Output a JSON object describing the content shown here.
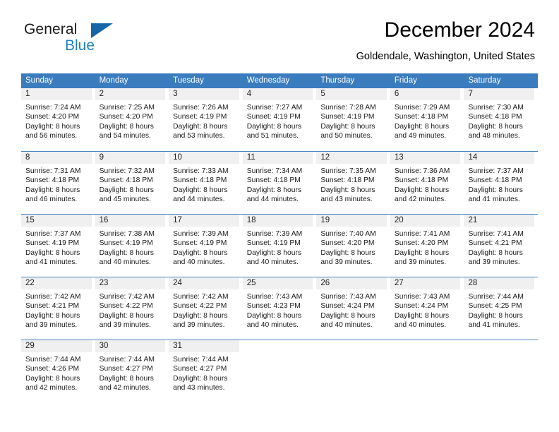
{
  "brand": {
    "name_top": "General",
    "name_bottom": "Blue",
    "triangle_color": "#1565a8",
    "blue_color": "#1e7fc4"
  },
  "header": {
    "title": "December 2024",
    "subtitle": "Goldendale, Washington, United States"
  },
  "theme": {
    "header_row_bg": "#3a7cbe",
    "header_row_text": "#ffffff",
    "day_number_bg": "#f0f0f0",
    "row_separator": "#4a84c0"
  },
  "calendar": {
    "weekday_headers": [
      "Sunday",
      "Monday",
      "Tuesday",
      "Wednesday",
      "Thursday",
      "Friday",
      "Saturday"
    ],
    "weeks": [
      [
        {
          "day": "1",
          "sunrise": "Sunrise: 7:24 AM",
          "sunset": "Sunset: 4:20 PM",
          "daylight_line1": "Daylight: 8 hours",
          "daylight_line2": "and 56 minutes."
        },
        {
          "day": "2",
          "sunrise": "Sunrise: 7:25 AM",
          "sunset": "Sunset: 4:20 PM",
          "daylight_line1": "Daylight: 8 hours",
          "daylight_line2": "and 54 minutes."
        },
        {
          "day": "3",
          "sunrise": "Sunrise: 7:26 AM",
          "sunset": "Sunset: 4:19 PM",
          "daylight_line1": "Daylight: 8 hours",
          "daylight_line2": "and 53 minutes."
        },
        {
          "day": "4",
          "sunrise": "Sunrise: 7:27 AM",
          "sunset": "Sunset: 4:19 PM",
          "daylight_line1": "Daylight: 8 hours",
          "daylight_line2": "and 51 minutes."
        },
        {
          "day": "5",
          "sunrise": "Sunrise: 7:28 AM",
          "sunset": "Sunset: 4:19 PM",
          "daylight_line1": "Daylight: 8 hours",
          "daylight_line2": "and 50 minutes."
        },
        {
          "day": "6",
          "sunrise": "Sunrise: 7:29 AM",
          "sunset": "Sunset: 4:18 PM",
          "daylight_line1": "Daylight: 8 hours",
          "daylight_line2": "and 49 minutes."
        },
        {
          "day": "7",
          "sunrise": "Sunrise: 7:30 AM",
          "sunset": "Sunset: 4:18 PM",
          "daylight_line1": "Daylight: 8 hours",
          "daylight_line2": "and 48 minutes."
        }
      ],
      [
        {
          "day": "8",
          "sunrise": "Sunrise: 7:31 AM",
          "sunset": "Sunset: 4:18 PM",
          "daylight_line1": "Daylight: 8 hours",
          "daylight_line2": "and 46 minutes."
        },
        {
          "day": "9",
          "sunrise": "Sunrise: 7:32 AM",
          "sunset": "Sunset: 4:18 PM",
          "daylight_line1": "Daylight: 8 hours",
          "daylight_line2": "and 45 minutes."
        },
        {
          "day": "10",
          "sunrise": "Sunrise: 7:33 AM",
          "sunset": "Sunset: 4:18 PM",
          "daylight_line1": "Daylight: 8 hours",
          "daylight_line2": "and 44 minutes."
        },
        {
          "day": "11",
          "sunrise": "Sunrise: 7:34 AM",
          "sunset": "Sunset: 4:18 PM",
          "daylight_line1": "Daylight: 8 hours",
          "daylight_line2": "and 44 minutes."
        },
        {
          "day": "12",
          "sunrise": "Sunrise: 7:35 AM",
          "sunset": "Sunset: 4:18 PM",
          "daylight_line1": "Daylight: 8 hours",
          "daylight_line2": "and 43 minutes."
        },
        {
          "day": "13",
          "sunrise": "Sunrise: 7:36 AM",
          "sunset": "Sunset: 4:18 PM",
          "daylight_line1": "Daylight: 8 hours",
          "daylight_line2": "and 42 minutes."
        },
        {
          "day": "14",
          "sunrise": "Sunrise: 7:37 AM",
          "sunset": "Sunset: 4:18 PM",
          "daylight_line1": "Daylight: 8 hours",
          "daylight_line2": "and 41 minutes."
        }
      ],
      [
        {
          "day": "15",
          "sunrise": "Sunrise: 7:37 AM",
          "sunset": "Sunset: 4:19 PM",
          "daylight_line1": "Daylight: 8 hours",
          "daylight_line2": "and 41 minutes."
        },
        {
          "day": "16",
          "sunrise": "Sunrise: 7:38 AM",
          "sunset": "Sunset: 4:19 PM",
          "daylight_line1": "Daylight: 8 hours",
          "daylight_line2": "and 40 minutes."
        },
        {
          "day": "17",
          "sunrise": "Sunrise: 7:39 AM",
          "sunset": "Sunset: 4:19 PM",
          "daylight_line1": "Daylight: 8 hours",
          "daylight_line2": "and 40 minutes."
        },
        {
          "day": "18",
          "sunrise": "Sunrise: 7:39 AM",
          "sunset": "Sunset: 4:19 PM",
          "daylight_line1": "Daylight: 8 hours",
          "daylight_line2": "and 40 minutes."
        },
        {
          "day": "19",
          "sunrise": "Sunrise: 7:40 AM",
          "sunset": "Sunset: 4:20 PM",
          "daylight_line1": "Daylight: 8 hours",
          "daylight_line2": "and 39 minutes."
        },
        {
          "day": "20",
          "sunrise": "Sunrise: 7:41 AM",
          "sunset": "Sunset: 4:20 PM",
          "daylight_line1": "Daylight: 8 hours",
          "daylight_line2": "and 39 minutes."
        },
        {
          "day": "21",
          "sunrise": "Sunrise: 7:41 AM",
          "sunset": "Sunset: 4:21 PM",
          "daylight_line1": "Daylight: 8 hours",
          "daylight_line2": "and 39 minutes."
        }
      ],
      [
        {
          "day": "22",
          "sunrise": "Sunrise: 7:42 AM",
          "sunset": "Sunset: 4:21 PM",
          "daylight_line1": "Daylight: 8 hours",
          "daylight_line2": "and 39 minutes."
        },
        {
          "day": "23",
          "sunrise": "Sunrise: 7:42 AM",
          "sunset": "Sunset: 4:22 PM",
          "daylight_line1": "Daylight: 8 hours",
          "daylight_line2": "and 39 minutes."
        },
        {
          "day": "24",
          "sunrise": "Sunrise: 7:42 AM",
          "sunset": "Sunset: 4:22 PM",
          "daylight_line1": "Daylight: 8 hours",
          "daylight_line2": "and 39 minutes."
        },
        {
          "day": "25",
          "sunrise": "Sunrise: 7:43 AM",
          "sunset": "Sunset: 4:23 PM",
          "daylight_line1": "Daylight: 8 hours",
          "daylight_line2": "and 40 minutes."
        },
        {
          "day": "26",
          "sunrise": "Sunrise: 7:43 AM",
          "sunset": "Sunset: 4:24 PM",
          "daylight_line1": "Daylight: 8 hours",
          "daylight_line2": "and 40 minutes."
        },
        {
          "day": "27",
          "sunrise": "Sunrise: 7:43 AM",
          "sunset": "Sunset: 4:24 PM",
          "daylight_line1": "Daylight: 8 hours",
          "daylight_line2": "and 40 minutes."
        },
        {
          "day": "28",
          "sunrise": "Sunrise: 7:44 AM",
          "sunset": "Sunset: 4:25 PM",
          "daylight_line1": "Daylight: 8 hours",
          "daylight_line2": "and 41 minutes."
        }
      ],
      [
        {
          "day": "29",
          "sunrise": "Sunrise: 7:44 AM",
          "sunset": "Sunset: 4:26 PM",
          "daylight_line1": "Daylight: 8 hours",
          "daylight_line2": "and 42 minutes."
        },
        {
          "day": "30",
          "sunrise": "Sunrise: 7:44 AM",
          "sunset": "Sunset: 4:27 PM",
          "daylight_line1": "Daylight: 8 hours",
          "daylight_line2": "and 42 minutes."
        },
        {
          "day": "31",
          "sunrise": "Sunrise: 7:44 AM",
          "sunset": "Sunset: 4:27 PM",
          "daylight_line1": "Daylight: 8 hours",
          "daylight_line2": "and 43 minutes."
        },
        {
          "day": "",
          "sunrise": "",
          "sunset": "",
          "daylight_line1": "",
          "daylight_line2": ""
        },
        {
          "day": "",
          "sunrise": "",
          "sunset": "",
          "daylight_line1": "",
          "daylight_line2": ""
        },
        {
          "day": "",
          "sunrise": "",
          "sunset": "",
          "daylight_line1": "",
          "daylight_line2": ""
        },
        {
          "day": "",
          "sunrise": "",
          "sunset": "",
          "daylight_line1": "",
          "daylight_line2": ""
        }
      ]
    ]
  }
}
